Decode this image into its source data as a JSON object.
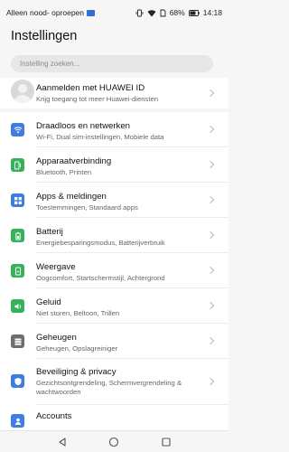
{
  "status_bar": {
    "carrier": "Alleen nood- oproepen",
    "battery": "68%",
    "time": "14:18"
  },
  "title": "Instellingen",
  "search": {
    "placeholder": "Instelling zoeken..."
  },
  "account": {
    "title": "Aanmelden met HUAWEI ID",
    "subtitle": "Krijg toegang tot meer Huawei-diensten"
  },
  "items": [
    {
      "title": "Draadloos en netwerken",
      "subtitle": "Wi-Fi, Dual sim-instellingen, Mobiele data",
      "icon": "wifi-icon",
      "color": "#3f7de0"
    },
    {
      "title": "Apparaatverbinding",
      "subtitle": "Bluetooth, Printen",
      "icon": "device-connection-icon",
      "color": "#35b25a"
    },
    {
      "title": "Apps & meldingen",
      "subtitle": "Toestemmingen, Standaard apps",
      "icon": "apps-icon",
      "color": "#3f7de0"
    },
    {
      "title": "Batterij",
      "subtitle": "Energiebesparingsmodus, Batterijverbruik",
      "icon": "battery-icon",
      "color": "#35b25a"
    },
    {
      "title": "Weergave",
      "subtitle": "Oogcomfort, Startschermstijl, Achtergrond",
      "icon": "display-icon",
      "color": "#35b25a"
    },
    {
      "title": "Geluid",
      "subtitle": "Niet storen, Beltoon, Trillen",
      "icon": "sound-icon",
      "color": "#35b25a"
    },
    {
      "title": "Geheugen",
      "subtitle": "Geheugen, Opslagreiniger",
      "icon": "storage-icon",
      "color": "#6e6e6e"
    },
    {
      "title": "Beveiliging & privacy",
      "subtitle": "Gezichtsontgrendeling, Schermvergrendeling & wachtwoorden",
      "icon": "shield-icon",
      "color": "#3f7de0"
    },
    {
      "title": "Accounts",
      "subtitle": "",
      "icon": "accounts-icon",
      "color": "#3f7de0"
    }
  ]
}
